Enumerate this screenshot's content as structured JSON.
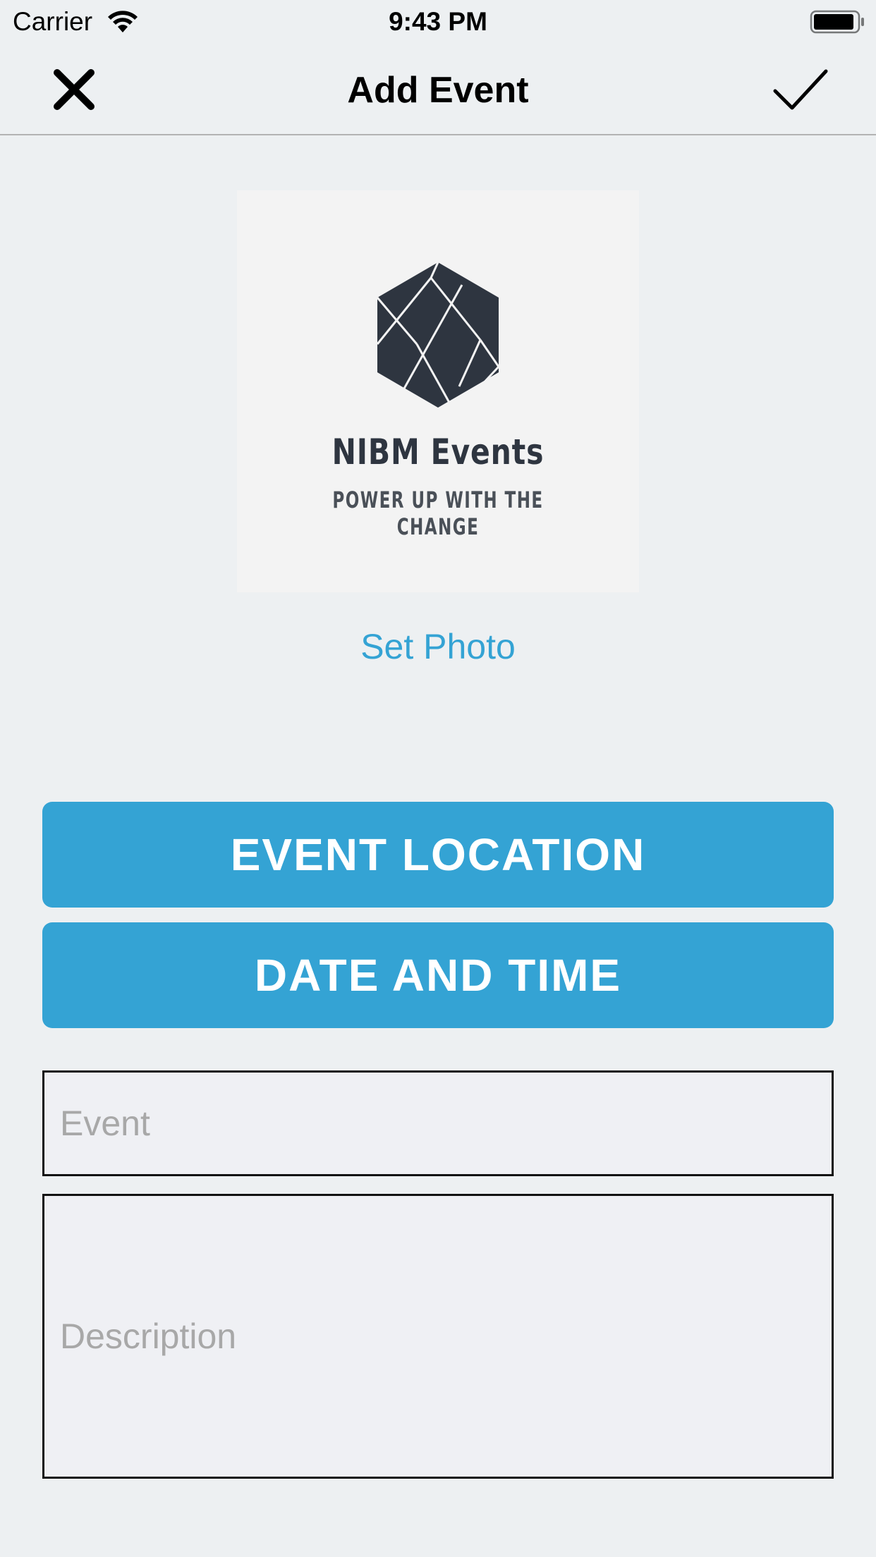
{
  "status_bar": {
    "carrier": "Carrier",
    "time": "9:43 PM"
  },
  "nav": {
    "title": "Add Event",
    "close_icon": "close-icon",
    "done_icon": "checkmark-icon"
  },
  "photo": {
    "logo_title": "NIBM Events",
    "logo_tagline": "POWER UP WITH THE CHANGE",
    "set_photo_label": "Set Photo"
  },
  "buttons": {
    "event_location": "EVENT LOCATION",
    "date_and_time": "DATE AND TIME"
  },
  "fields": {
    "event_placeholder": "Event",
    "description_placeholder": "Description"
  },
  "colors": {
    "accent": "#34a3d4",
    "background": "#edf0f2",
    "logo_dark": "#2e3540"
  }
}
